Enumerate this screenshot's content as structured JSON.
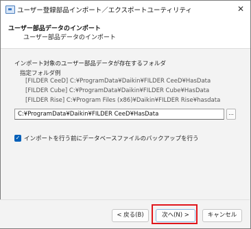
{
  "window": {
    "title": "ユーザー登録部品インポート／エクスポートユーティリティ"
  },
  "header": {
    "title": "ユーザー部品データのインポート",
    "subtitle": "ユーザー部品データのインポート"
  },
  "content": {
    "instruction": "インポート対象のユーザー部品データが存在するフォルダ",
    "example_label": "指定フォルダ例",
    "example_paths": [
      "[FILDER CeeD] C:¥ProgramData¥Daikin¥FILDER CeeD¥HasData",
      "[FILDER Cube] C:¥ProgramData¥Daikin¥FILDER Cube¥HasData",
      "[FILDER Rise] C:¥Program Files (x86)¥Daikin¥FILDER Rise¥hasdata"
    ],
    "folder_path_value": "C:¥ProgramData¥Daikin¥FILDER CeeD¥HasData",
    "browse_label": "...",
    "backup_checkbox": {
      "label": "インポートを行う前にデータベースファイルのバックアップを行う",
      "checked": true
    }
  },
  "buttons": {
    "back": "< 戻る(B)",
    "next": "次へ(N) >",
    "cancel": "キャンセル"
  },
  "colors": {
    "accent": "#005fb8",
    "highlight": "#e0151b"
  }
}
